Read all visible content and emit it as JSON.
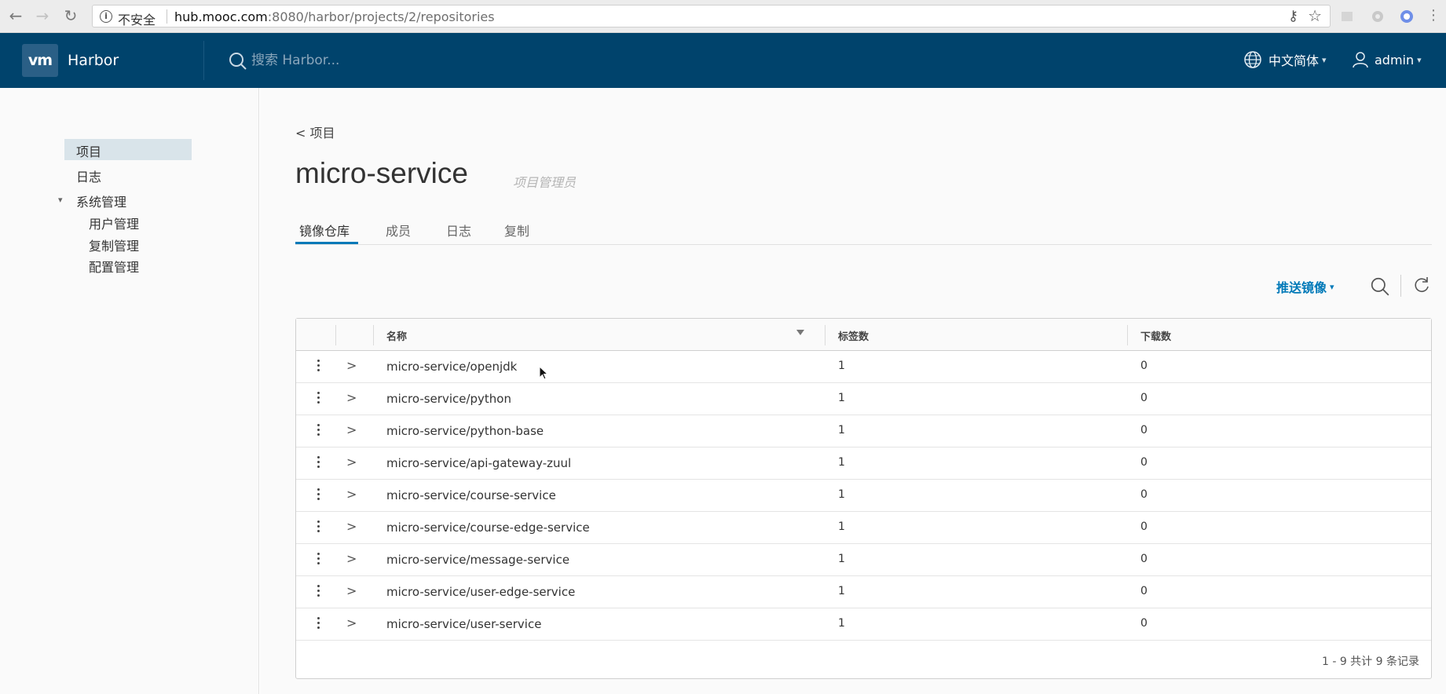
{
  "browser": {
    "security_label": "不安全",
    "url_host": "hub.mooc.com",
    "url_path": ":8080/harbor/projects/2/repositories"
  },
  "header": {
    "brand_logo": "vm",
    "brand_name": "Harbor",
    "search_placeholder": "搜索 Harbor...",
    "language": "中文简体",
    "user": "admin"
  },
  "sidebar": {
    "items": [
      {
        "label": "项目",
        "active": true
      },
      {
        "label": "日志"
      },
      {
        "label": "系统管理"
      }
    ],
    "admin_children": [
      {
        "label": "用户管理"
      },
      {
        "label": "复制管理"
      },
      {
        "label": "配置管理"
      }
    ]
  },
  "main": {
    "back_label": "< 项目",
    "project_name": "micro-service",
    "role": "项目管理员",
    "tabs": [
      {
        "label": "镜像仓库",
        "active": true
      },
      {
        "label": "成员"
      },
      {
        "label": "日志"
      },
      {
        "label": "复制"
      }
    ],
    "push_label": "推送镜像"
  },
  "table": {
    "columns": [
      "名称",
      "标签数",
      "下载数"
    ],
    "rows": [
      {
        "name": "micro-service/openjdk",
        "tags": "1",
        "pulls": "0"
      },
      {
        "name": "micro-service/python",
        "tags": "1",
        "pulls": "0"
      },
      {
        "name": "micro-service/python-base",
        "tags": "1",
        "pulls": "0"
      },
      {
        "name": "micro-service/api-gateway-zuul",
        "tags": "1",
        "pulls": "0"
      },
      {
        "name": "micro-service/course-service",
        "tags": "1",
        "pulls": "0"
      },
      {
        "name": "micro-service/course-edge-service",
        "tags": "1",
        "pulls": "0"
      },
      {
        "name": "micro-service/message-service",
        "tags": "1",
        "pulls": "0"
      },
      {
        "name": "micro-service/user-edge-service",
        "tags": "1",
        "pulls": "0"
      },
      {
        "name": "micro-service/user-service",
        "tags": "1",
        "pulls": "0"
      }
    ],
    "footer": "1 - 9 共计 9 条记录"
  },
  "colors": {
    "header_bg": "#00436c",
    "accent": "#0079b8"
  }
}
